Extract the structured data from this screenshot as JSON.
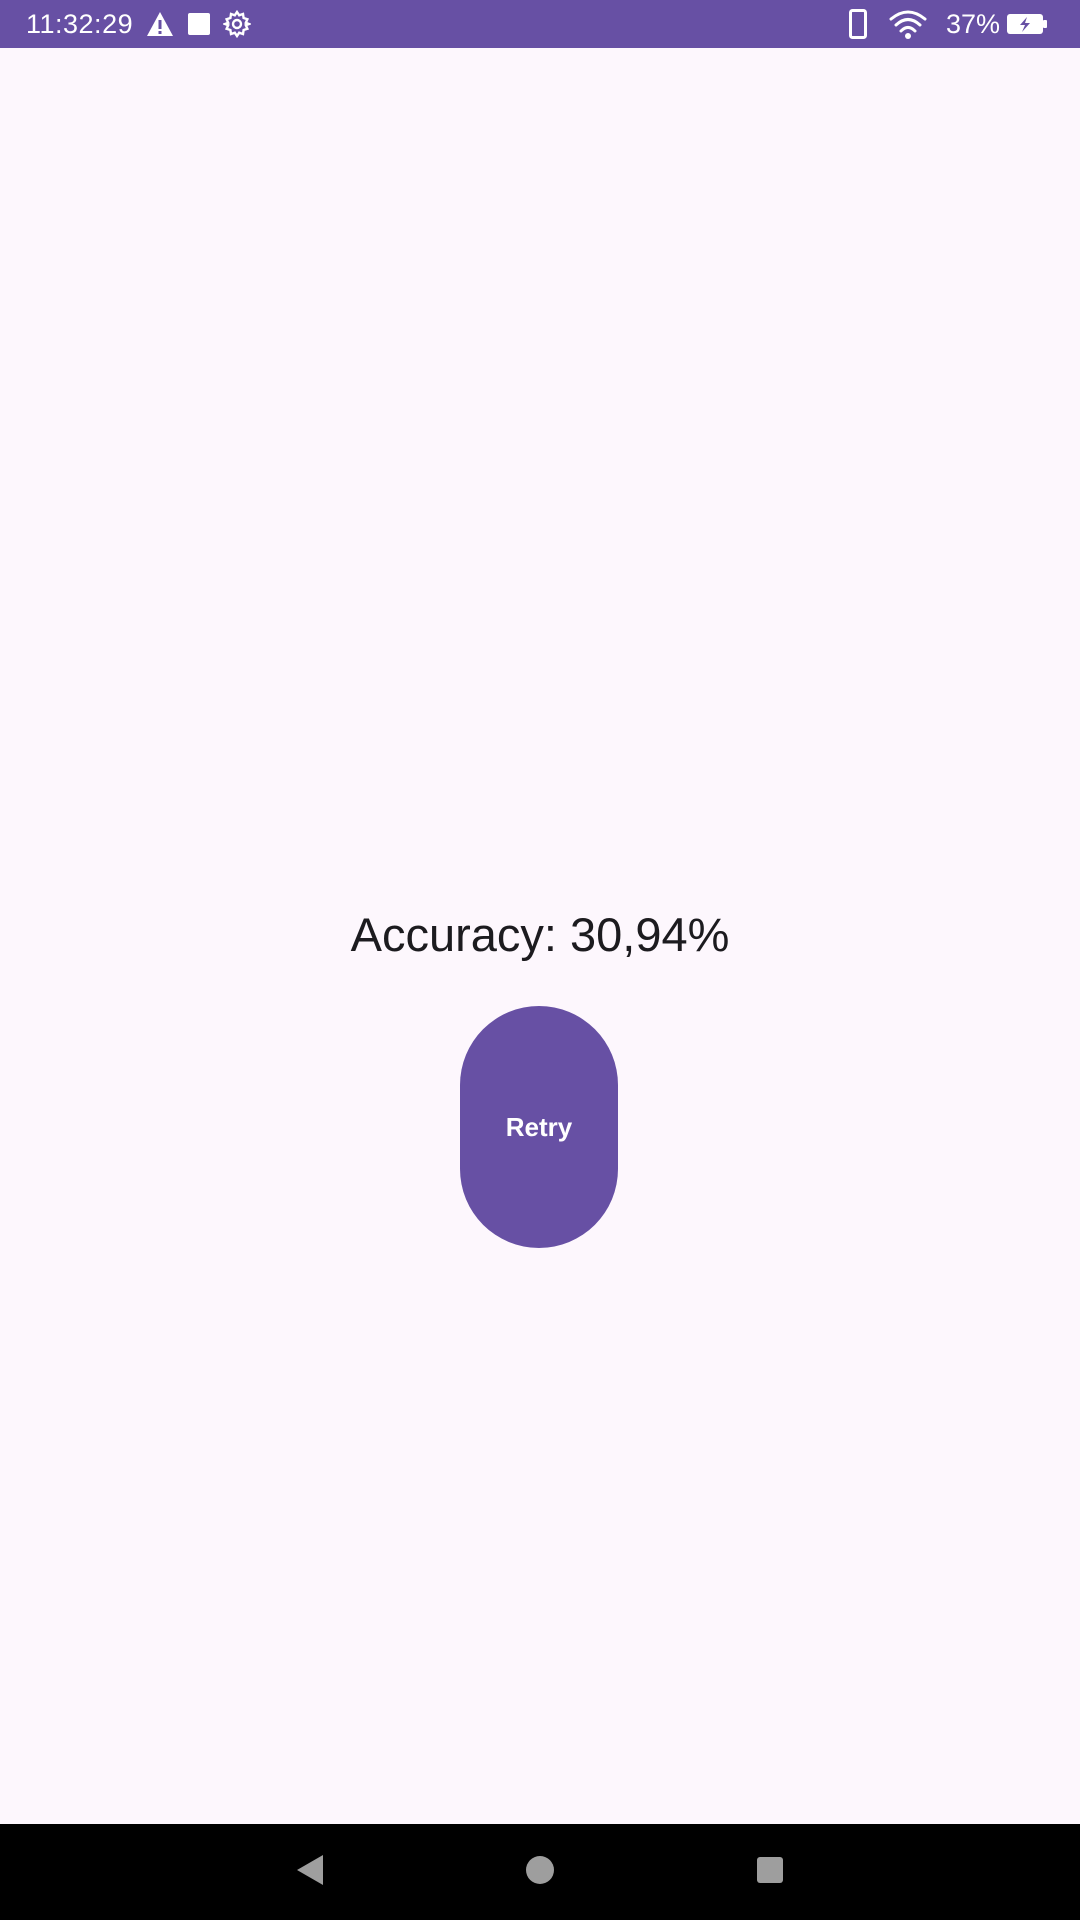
{
  "status_bar": {
    "time": "11:32:29",
    "battery": "37%",
    "background_color": "#6750a4",
    "icons": [
      "warning-icon",
      "square-notification-icon",
      "settings-icon",
      "phone-icon",
      "wifi-icon",
      "battery-charging-icon"
    ]
  },
  "main": {
    "accuracy_text": "Accuracy: 30,94%",
    "retry_label": "Retry",
    "accent_color": "#6750a4",
    "background_color": "#fdf7fd"
  },
  "nav_bar": {
    "icons": [
      "back-icon",
      "home-icon",
      "recents-icon"
    ]
  }
}
